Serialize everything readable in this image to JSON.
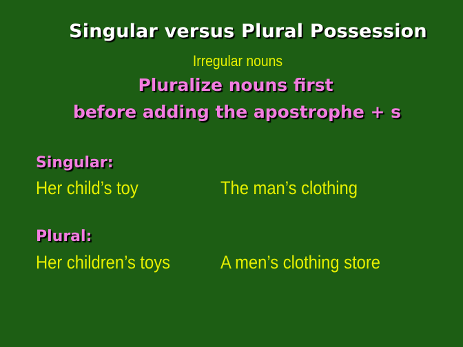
{
  "slide": {
    "title": "Singular versus Plural Possession",
    "subtitle": "Irregular nouns",
    "rule_line_1": "Pluralize nouns first",
    "rule_line_2": "before adding the apostrophe + s",
    "singular": {
      "label": "Singular:",
      "example_left": "Her child’s toy",
      "example_right": "The man’s clothing"
    },
    "plural": {
      "label": "Plural:",
      "example_left": "Her children’s toys",
      "example_right": "A men’s clothing store"
    }
  },
  "colors": {
    "background": "#1d5e14",
    "title": "#ffffff",
    "accent_pink": "#f27de0",
    "text_yellow": "#e6f000"
  }
}
